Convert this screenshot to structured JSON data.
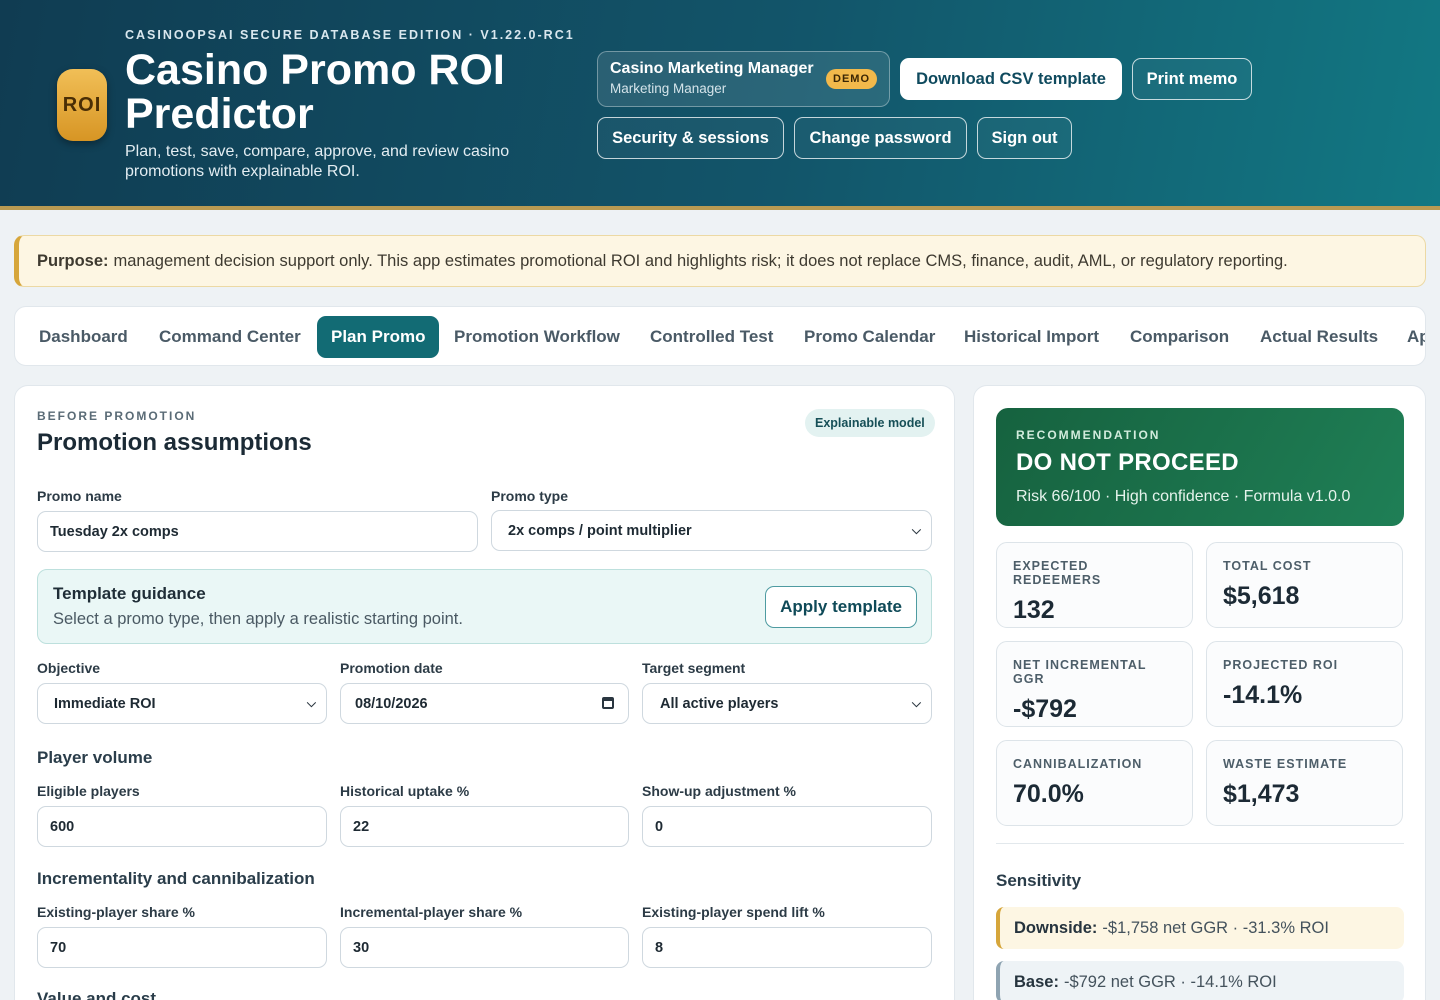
{
  "header": {
    "logo_text": "ROI",
    "edition": "CASINOOPSAI SECURE DATABASE EDITION · V1.22.0-RC1",
    "title": "Casino Promo ROI Predictor",
    "subtitle": "Plan, test, save, compare, approve, and review casino promotions with explainable ROI.",
    "user": {
      "name": "Casino Marketing Manager",
      "role": "Marketing Manager",
      "badge": "DEMO"
    },
    "buttons": {
      "download_csv": "Download CSV template",
      "print_memo": "Print memo",
      "security": "Security & sessions",
      "change_password": "Change password",
      "sign_out": "Sign out"
    }
  },
  "purpose": {
    "label": "Purpose:",
    "text": "management decision support only. This app estimates promotional ROI and highlights risk; it does not replace CMS, finance, audit, AML, or regulatory reporting."
  },
  "tabs": [
    "Dashboard",
    "Command Center",
    "Plan Promo",
    "Promotion Workflow",
    "Controlled Test",
    "Promo Calendar",
    "Historical Import",
    "Comparison",
    "Actual Results",
    "Ap"
  ],
  "active_tab": "Plan Promo",
  "form": {
    "eyebrow": "BEFORE PROMOTION",
    "title": "Promotion assumptions",
    "pill": "Explainable model",
    "promo_name": {
      "label": "Promo name",
      "value": "Tuesday 2x comps"
    },
    "promo_type": {
      "label": "Promo type",
      "value": "2x comps / point multiplier"
    },
    "guidance": {
      "title": "Template guidance",
      "text": "Select a promo type, then apply a realistic starting point.",
      "button": "Apply template"
    },
    "objective": {
      "label": "Objective",
      "value": "Immediate ROI"
    },
    "promotion_date": {
      "label": "Promotion date",
      "value": "08/10/2026"
    },
    "target_segment": {
      "label": "Target segment",
      "value": "All active players"
    },
    "player_volume": {
      "heading": "Player volume",
      "eligible": {
        "label": "Eligible players",
        "value": "600"
      },
      "uptake": {
        "label": "Historical uptake %",
        "value": "22"
      },
      "showup": {
        "label": "Show-up adjustment %",
        "value": "0"
      }
    },
    "incrementality": {
      "heading": "Incrementality and cannibalization",
      "existing_share": {
        "label": "Existing-player share %",
        "value": "70"
      },
      "incremental_share": {
        "label": "Incremental-player share %",
        "value": "30"
      },
      "spend_lift": {
        "label": "Existing-player spend lift %",
        "value": "8"
      }
    },
    "value_cost_heading": "Value and cost"
  },
  "results": {
    "recommendation": {
      "eyebrow": "RECOMMENDATION",
      "verdict": "DO NOT PROCEED",
      "detail": "Risk 66/100 · High confidence · Formula v1.0.0"
    },
    "kpis": [
      {
        "label": "EXPECTED REDEEMERS",
        "value": "132"
      },
      {
        "label": "TOTAL COST",
        "value": "$5,618"
      },
      {
        "label": "NET INCREMENTAL GGR",
        "value": "-$792"
      },
      {
        "label": "PROJECTED ROI",
        "value": "-14.1%"
      },
      {
        "label": "CANNIBALIZATION",
        "value": "70.0%"
      },
      {
        "label": "WASTE ESTIMATE",
        "value": "$1,473"
      }
    ],
    "sensitivity": {
      "heading": "Sensitivity",
      "downside": {
        "label": "Downside:",
        "text": "-$1,758 net GGR · -31.3% ROI"
      },
      "base": {
        "label": "Base:",
        "text": "-$792 net GGR · -14.1% ROI"
      }
    }
  },
  "colors": {
    "header_start": "#103c52",
    "header_end": "#127883",
    "accent": "#126b74",
    "gold": "#d6a63b",
    "recommend_green": "#1f7f56"
  }
}
